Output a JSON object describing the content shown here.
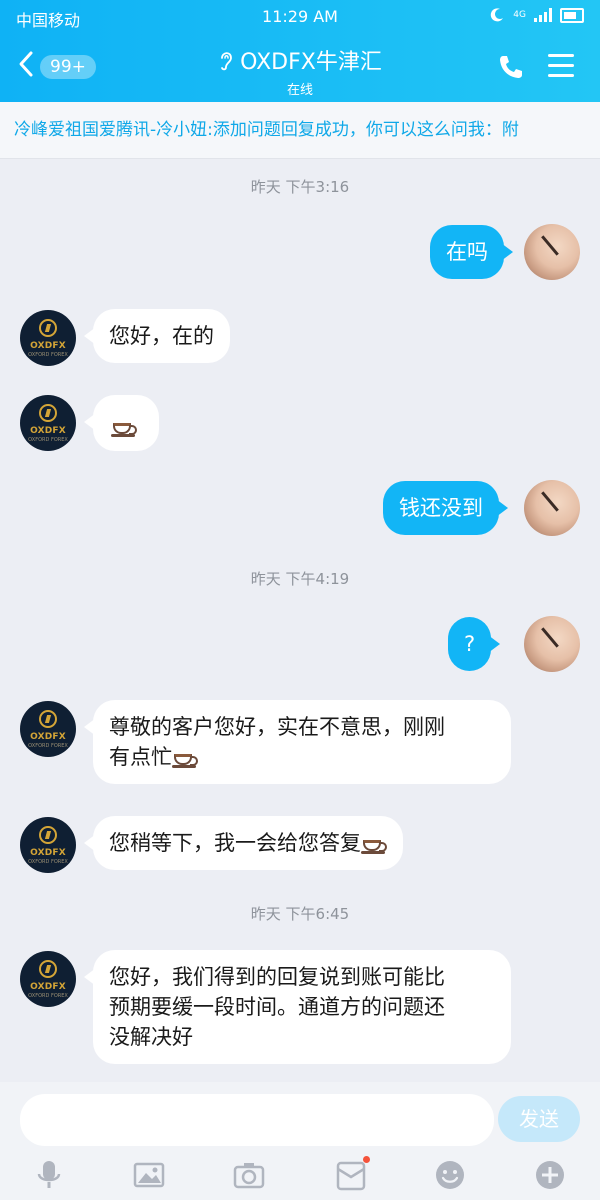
{
  "status_bar": {
    "carrier": "中国移动",
    "time": "11:29 AM",
    "network": "4G"
  },
  "header": {
    "back_badge": "99+",
    "title": "OXDFX牛津汇",
    "subtitle": "在线"
  },
  "ticker": {
    "text": "冷峰爱祖国爱腾讯-冷小妞:添加问题回复成功，你可以这么问我：附"
  },
  "chat": {
    "timestamps": [
      "昨天 下午3:16",
      "昨天 下午4:19",
      "昨天 下午6:45"
    ],
    "messages": {
      "m1": "在吗",
      "m2": "您好，在的",
      "m4": "钱还没到",
      "m5": "?",
      "m6_line1": "尊敬的客户您好，实在不意思，刚刚",
      "m6_line2": "有点忙",
      "m7": "您稍等下，我一会给您答复",
      "m8_line1": "您好，我们得到的回复说到账可能比",
      "m8_line2": "预期要缓一段时间。通道方的问题还",
      "m8_line3": "没解决好"
    },
    "avatar": {
      "brand": "OXDFX",
      "brand_sub": "OXFORD FOREX"
    }
  },
  "input": {
    "placeholder": "",
    "send_label": "发送"
  },
  "colors": {
    "accent": "#12b5f6",
    "header_gradient_start": "#0fb2f5",
    "header_gradient_end": "#23c6f5",
    "background": "#eceef4",
    "notification_dot": "#f5533b"
  },
  "icons": [
    "back-chevron-icon",
    "ear-icon",
    "phone-icon",
    "menu-icon",
    "microphone-icon",
    "image-icon",
    "camera-icon",
    "red-packet-icon",
    "emoji-icon",
    "plus-icon"
  ]
}
